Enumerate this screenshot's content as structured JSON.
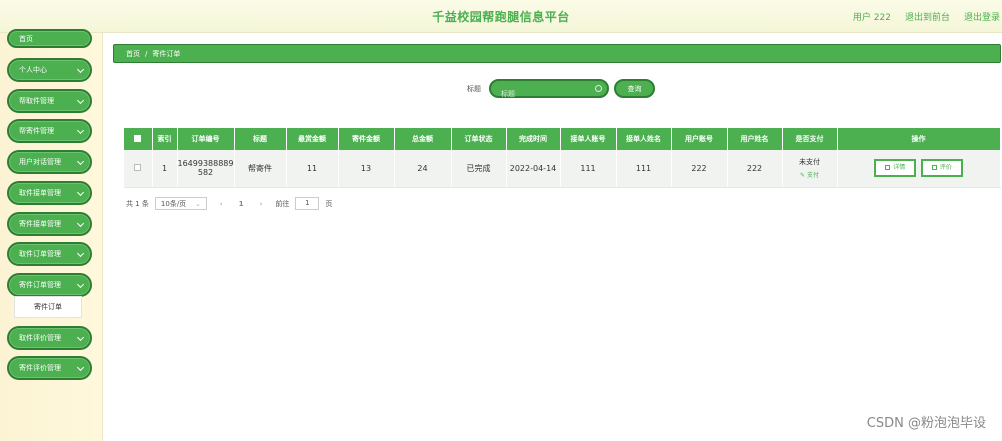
{
  "header": {
    "title": "千益校园帮跑腿信息平台",
    "user": "用户 222",
    "back_front": "退出到前台",
    "logout": "退出登录"
  },
  "sidebar": {
    "items": [
      {
        "label": "首页"
      },
      {
        "label": "个人中心"
      },
      {
        "label": "帮取件管理"
      },
      {
        "label": "帮寄件管理"
      },
      {
        "label": "用户对话管理"
      },
      {
        "label": "取件接单管理"
      },
      {
        "label": "寄件接单管理"
      },
      {
        "label": "取件订单管理"
      },
      {
        "label": "寄件订单管理"
      },
      {
        "label": "取件评价管理"
      },
      {
        "label": "寄件评价管理"
      }
    ],
    "sub_item": "寄件订单"
  },
  "breadcrumb": {
    "home": "首页",
    "sep": "/",
    "current": "寄件订单"
  },
  "search": {
    "label": "标题",
    "placeholder": "标题",
    "button": "查询"
  },
  "table": {
    "headers": [
      "索引",
      "订单编号",
      "标题",
      "悬赏金额",
      "寄件金额",
      "总金额",
      "订单状态",
      "完成时间",
      "接单人账号",
      "接单人姓名",
      "用户账号",
      "用户姓名",
      "是否支付",
      "操作"
    ],
    "rows": [
      {
        "index": "1",
        "order_no_a": "16499388889",
        "order_no_b": "582",
        "title": "帮寄件",
        "reward": "11",
        "send_amount": "13",
        "total": "24",
        "status": "已完成",
        "finish_time": "2022-04-14",
        "taker_account": "111",
        "taker_name": "111",
        "user_account": "222",
        "user_name": "222",
        "paid": "未支付",
        "pay_action": "支付"
      }
    ],
    "ops": {
      "detail": "详情",
      "review": "评价"
    }
  },
  "pagination": {
    "total": "共 1 条",
    "page_size": "10条/页",
    "prev": "‹",
    "current": "1",
    "next": "›",
    "goto_prefix": "前往",
    "goto_value": "1",
    "goto_suffix": "页"
  },
  "watermark": "CSDN @粉泡泡毕设",
  "colors": {
    "accent": "#4caf50",
    "accent_dark": "#2e7d32",
    "sidebar_bg": "#fbf3d3"
  }
}
